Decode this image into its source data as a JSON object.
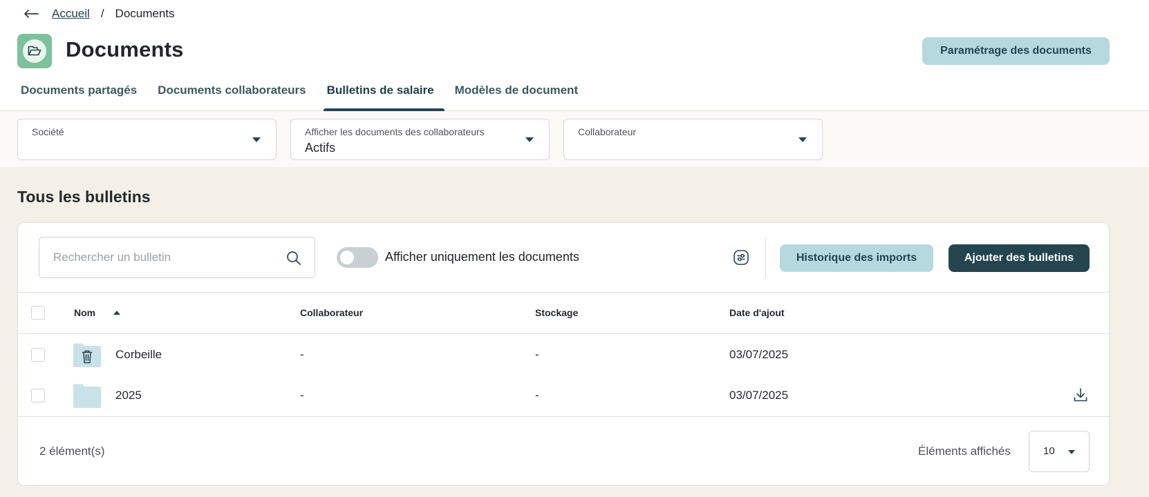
{
  "breadcrumb": {
    "home": "Accueil",
    "separator": "/",
    "current": "Documents"
  },
  "page": {
    "title": "Documents",
    "icon": "open-folder-icon"
  },
  "header": {
    "settings_button": "Paramétrage des documents"
  },
  "tabs": [
    {
      "label": "Documents partagés",
      "active": false
    },
    {
      "label": "Documents collaborateurs",
      "active": false
    },
    {
      "label": "Bulletins de salaire",
      "active": true
    },
    {
      "label": "Modèles de document",
      "active": false
    }
  ],
  "filters": {
    "company": {
      "label": "Société",
      "value": ""
    },
    "show_docs": {
      "label": "Afficher les documents des collaborateurs",
      "value": "Actifs"
    },
    "employee": {
      "label": "Collaborateur",
      "value": ""
    }
  },
  "section": {
    "title": "Tous les bulletins"
  },
  "toolbar": {
    "search_placeholder": "Rechercher un bulletin",
    "toggle_label": "Afficher uniquement les documents",
    "toggle_on": false,
    "history_button": "Historique des imports",
    "add_button": "Ajouter des bulletins"
  },
  "table": {
    "columns": {
      "name": "Nom",
      "employee": "Collaborateur",
      "storage": "Stockage",
      "date": "Date d'ajout"
    },
    "rows": [
      {
        "name": "Corbeille",
        "employee": "-",
        "storage": "-",
        "date": "03/07/2025",
        "icon": "trash-folder-icon"
      },
      {
        "name": "2025",
        "employee": "-",
        "storage": "-",
        "date": "03/07/2025",
        "icon": "folder-icon"
      }
    ]
  },
  "footer": {
    "count": "2 élément(s)",
    "per_page_label": "Éléments affichés",
    "per_page_value": "10"
  },
  "colors": {
    "primary": "#24444f",
    "secondary": "#b6d8df",
    "page_bg": "#f4f0e8",
    "folder": "#c9e2e7",
    "icon_green": "#7cc29d"
  }
}
